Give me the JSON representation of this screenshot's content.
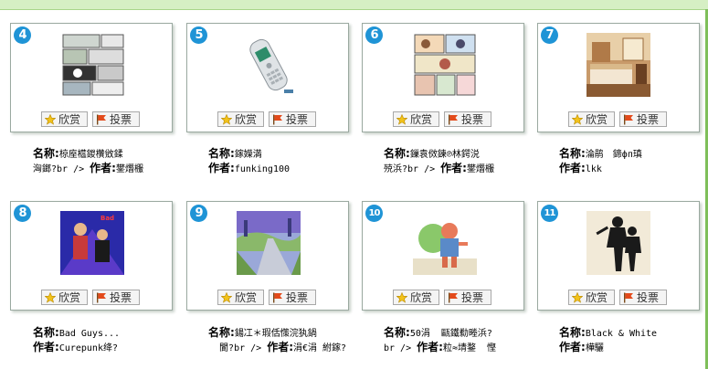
{
  "buttons": {
    "appreciate": "欣赏",
    "vote": "投票"
  },
  "labels": {
    "name": "名称:",
    "author": "作者:"
  },
  "colors": {
    "badge": "#1f94d6",
    "star": "#f2c21b",
    "flag": "#e34a1b",
    "topbar": "#d6efc4"
  },
  "cards": [
    {
      "rank": "4",
      "thumb": "comic-strip",
      "name": "椋庢櫙鍐欑敓鍒",
      "author_prefix": "洶鎯?br />",
      "author": "鐢熸棴"
    },
    {
      "rank": "5",
      "thumb": "mobile-phone",
      "name": "鎵嬫満",
      "author_prefix": "",
      "author": "funking100"
    },
    {
      "rank": "6",
      "thumb": "comic-page",
      "name": "鏁袁傚鍊℗林鍔涚",
      "author_prefix": "殑浜?br />",
      "author": "鐢熸棴"
    },
    {
      "rank": "7",
      "thumb": "bedroom",
      "name": "淪鹃　鍗фп瑱",
      "author_prefix": "",
      "author": "lkk"
    },
    {
      "rank": "8",
      "thumb": "band-poster",
      "name": "Bad Guys...",
      "author_prefix": "",
      "author": "Curepunk绛?"
    },
    {
      "rank": "9",
      "thumb": "landscape-road",
      "name": "鍚冮＊瑕佸憡浣犱鍋",
      "author_prefix": "閬?br />",
      "author": "涓€涓 紨鎵?"
    },
    {
      "rank": "10",
      "thumb": "cartoon-boy",
      "name": "50涓  甌鐵勬畻浜?",
      "author_prefix": "br />",
      "author": "粒≈埥鍪  慳"
    },
    {
      "rank": "11",
      "thumb": "silhouette",
      "name": "Black & White",
      "author_prefix": "",
      "author": "樺驪"
    }
  ]
}
